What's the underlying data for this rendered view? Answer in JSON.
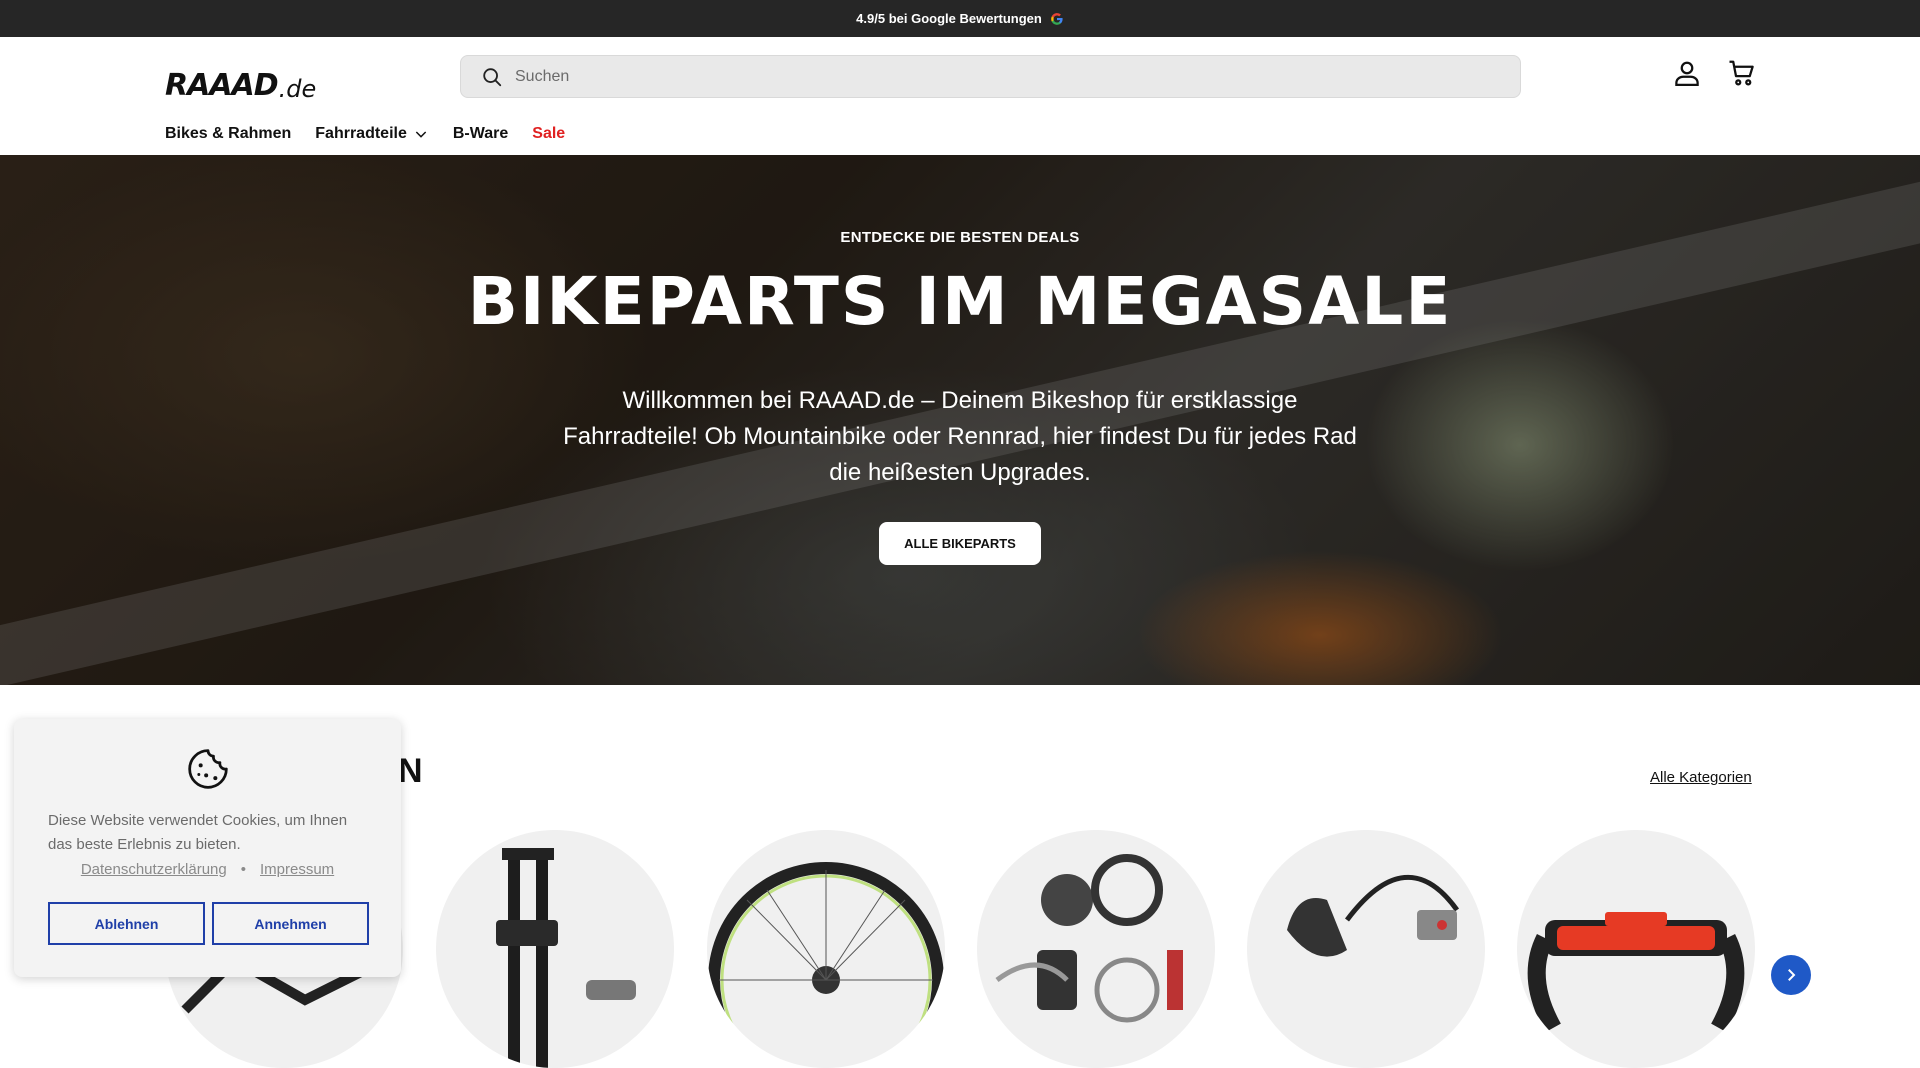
{
  "announcement": {
    "text": "4.9/5 bei Google Bewertungen",
    "icon": "google-icon"
  },
  "header": {
    "logo_main": "RAAAD",
    "logo_tld": ".de",
    "search_placeholder": "Suchen",
    "account_icon": "user-icon",
    "cart_icon": "cart-icon"
  },
  "nav": {
    "items": [
      {
        "label": "Bikes & Rahmen"
      },
      {
        "label": "Fahrradteile",
        "icon": "chevron-down-icon"
      },
      {
        "label": "B-Ware"
      },
      {
        "label": "Sale",
        "color": "#e02121"
      }
    ]
  },
  "hero": {
    "kicker": "ENTDECKE DIE BESTEN DEALS",
    "title": "BIKEPARTS IM MEGASALE",
    "text": "Willkommen bei RAAAD.de – Deinem Bikeshop für erstklassige Fahrradteile! Ob Mountainbike oder Rennrad, hier findest Du für jedes Rad die heißesten Upgrades.",
    "button": "ALLE BIKEPARTS"
  },
  "categories": {
    "title_partial": "N",
    "all_link": "Alle Kategorien",
    "items": [
      "bike-frame",
      "suspension-fork",
      "wheel",
      "groupset",
      "brake-shifter",
      "handlebar"
    ],
    "next_icon": "chevron-right-icon",
    "accent": "#1f59c7"
  },
  "cookie": {
    "icon": "cookie-icon",
    "text": "Diese Website verwendet Cookies, um Ihnen das beste Erlebnis zu bieten.",
    "link_privacy": "Datenschutzerklärung",
    "separator": "•",
    "link_imprint": "Impressum",
    "decline": "Ablehnen",
    "accept": "Annehmen",
    "button_color": "#1f3fa8"
  }
}
